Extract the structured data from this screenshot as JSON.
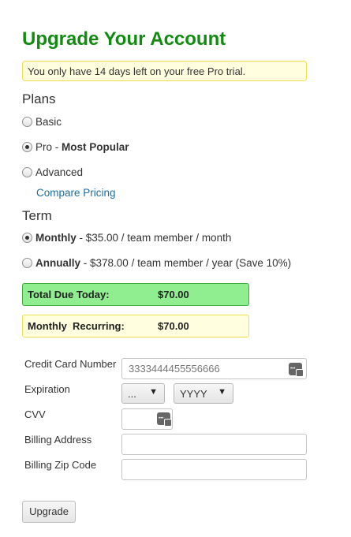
{
  "header": {
    "title": "Upgrade Your Account"
  },
  "notice": {
    "text": "You only have 14 days left on your free Pro trial."
  },
  "plans": {
    "heading": "Plans",
    "options": [
      {
        "label": "Basic",
        "selected": false
      },
      {
        "label": "Pro - ",
        "strong": "Most Popular",
        "selected": true
      },
      {
        "label": "Advanced",
        "selected": false
      }
    ],
    "compare_link": "Compare Pricing"
  },
  "term": {
    "heading": "Term",
    "options": [
      {
        "strong": "Monthly",
        "label": " - $35.00 / team member / month",
        "selected": true
      },
      {
        "strong": "Annually",
        "label": " - $378.00 / team member / year (Save 10%)",
        "selected": false
      }
    ]
  },
  "summary": {
    "total_label": "Total Due Today:",
    "total_value": "$70.00",
    "recurring_label": "Monthly  Recurring:",
    "recurring_value": "$70.00"
  },
  "form": {
    "card_label": "Credit Card Number",
    "card_value": "3333444455556666",
    "expiration_label": "Expiration",
    "month_value": "...",
    "year_value": "YYYY",
    "cvv_label": "CVV",
    "cvv_value": "",
    "address_label": "Billing Address",
    "address_value": "",
    "zip_label": "Billing Zip Code",
    "zip_value": ""
  },
  "actions": {
    "upgrade_label": "Upgrade"
  },
  "colors": {
    "title": "#118c11",
    "notice_bg": "#ffffe0",
    "total_bg": "#90ee90",
    "link": "#1f6e9e"
  }
}
